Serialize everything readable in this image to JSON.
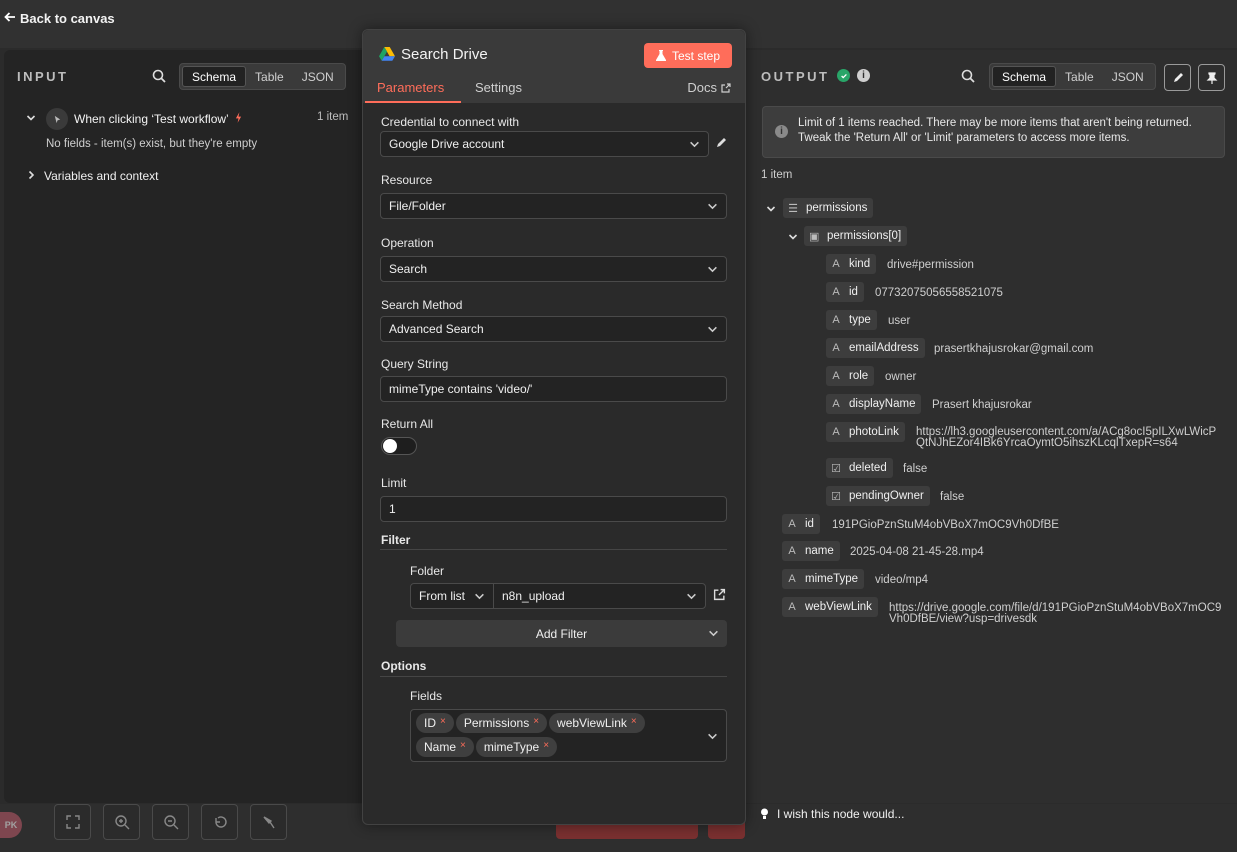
{
  "topbar": {
    "back_label": "Back to canvas"
  },
  "input": {
    "title": "INPUT",
    "views": [
      "Schema",
      "Table",
      "JSON"
    ],
    "active_view": "Schema",
    "trigger_label": "When clicking ‘Test workflow’",
    "trigger_count": "1 item",
    "empty_text": "No fields - item(s) exist, but they're empty",
    "vars_label": "Variables and context"
  },
  "node": {
    "title": "Search Drive",
    "test_button": "Test step",
    "tabs": [
      "Parameters",
      "Settings"
    ],
    "docs_label": "Docs",
    "credential_label": "Credential to connect with",
    "credential_value": "Google Drive account",
    "resource_label": "Resource",
    "resource_value": "File/Folder",
    "operation_label": "Operation",
    "operation_value": "Search",
    "method_label": "Search Method",
    "method_value": "Advanced Search",
    "query_label": "Query String",
    "query_value": "mimeType contains 'video/'",
    "return_all_label": "Return All",
    "return_all_value": false,
    "limit_label": "Limit",
    "limit_value": "1",
    "filter_label": "Filter",
    "folder_label": "Folder",
    "folder_mode": "From list",
    "folder_value": "n8n_upload",
    "add_filter_label": "Add Filter",
    "options_label": "Options",
    "fields_label": "Fields",
    "fields": [
      "ID",
      "Permissions",
      "webViewLink",
      "Name",
      "mimeType"
    ]
  },
  "output": {
    "title": "OUTPUT",
    "views": [
      "Schema",
      "Table",
      "JSON"
    ],
    "active_view": "Schema",
    "notice_line1": "Limit of 1 items reached. There may be more items that aren't being returned.",
    "notice_line2": "Tweak the 'Return All' or 'Limit' parameters to access more items.",
    "count": "1 item",
    "permissions_key": "permissions",
    "permissions0_key": "permissions[0]",
    "perm_fields": [
      {
        "type": "A",
        "key": "kind",
        "value": "drive#permission"
      },
      {
        "type": "A",
        "key": "id",
        "value": "07732075056558521075"
      },
      {
        "type": "A",
        "key": "type",
        "value": "user"
      },
      {
        "type": "A",
        "key": "emailAddress",
        "value": "prasertkhajusrokar@gmail.com"
      },
      {
        "type": "A",
        "key": "role",
        "value": "owner"
      },
      {
        "type": "A",
        "key": "displayName",
        "value": "Prasert khajusrokar"
      },
      {
        "type": "A",
        "key": "photoLink",
        "value_line1": "https://lh3.googleusercontent.com/a/ACg8ocI5pILXwLWicP",
        "value_line2": "QtNJhEZor4IBk6YrcaOymtO5ihszKLcqlTxepR=s64"
      },
      {
        "type": "bool",
        "key": "deleted",
        "value": "false"
      },
      {
        "type": "bool",
        "key": "pendingOwner",
        "value": "false"
      }
    ],
    "root_fields": [
      {
        "type": "A",
        "key": "id",
        "value": "191PGioPznStuM4obVBoX7mOC9Vh0DfBE"
      },
      {
        "type": "A",
        "key": "name",
        "value": "2025-04-08 21-45-28.mp4"
      },
      {
        "type": "A",
        "key": "mimeType",
        "value": "video/mp4"
      },
      {
        "type": "A",
        "key": "webViewLink",
        "value_line1": "https://drive.google.com/file/d/191PGioPznStuM4obVBoX7mOC9",
        "value_line2": "Vh0DfBE/view?usp=drivesdk"
      }
    ],
    "wish_text": "I wish this node would..."
  },
  "canvas": {
    "avatar_initials": "PK"
  },
  "colors": {
    "accent": "#ff6d5a",
    "success": "#29a568",
    "panel_bg": "#242424",
    "modal_bg": "#2a2a2a"
  }
}
